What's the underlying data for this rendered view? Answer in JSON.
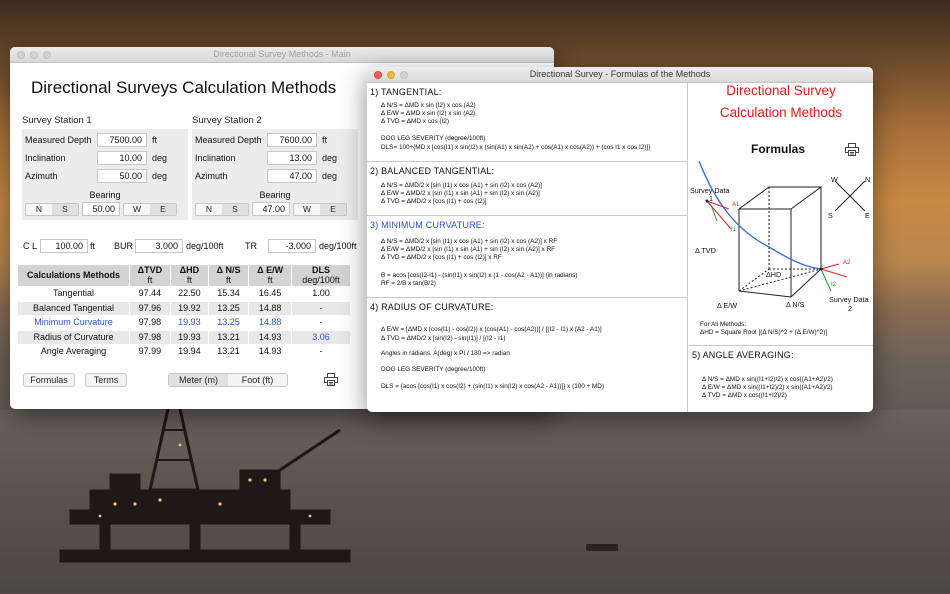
{
  "main": {
    "window_title": "Directional Survey Methods - Main",
    "app_title": "Directional Surveys Calculation Methods",
    "stations": [
      {
        "label": "Survey Station 1",
        "md_label": "Measured Depth",
        "md": "7500.00",
        "md_unit": "ft",
        "inc_label": "Inclination",
        "inc": "10.00",
        "inc_unit": "deg",
        "az_label": "Azimuth",
        "az": "50.00",
        "az_unit": "deg",
        "bearing_label": "Bearing",
        "ns": [
          "N",
          "S"
        ],
        "bearing": "50.00",
        "ew": [
          "W",
          "E"
        ]
      },
      {
        "label": "Survey Station 2",
        "md_label": "Measured Depth",
        "md": "7600.00",
        "md_unit": "ft",
        "inc_label": "Inclination",
        "inc": "13.00",
        "inc_unit": "deg",
        "az_label": "Azimuth",
        "az": "47.00",
        "az_unit": "deg",
        "bearing_label": "Bearing",
        "ns": [
          "N",
          "S"
        ],
        "bearing": "47.00",
        "ew": [
          "W",
          "E"
        ]
      }
    ],
    "cl_label": "C L",
    "cl": "100.00",
    "cl_unit": "ft",
    "bur_label": "BUR",
    "bur": "3.000",
    "bur_unit": "deg/100ft",
    "tr_label": "TR",
    "tr": "-3.000",
    "tr_unit": "deg/100ft",
    "table": {
      "headers": [
        {
          "name": "Calculations Methods",
          "unit": ""
        },
        {
          "name": "ΔTVD",
          "unit": "ft"
        },
        {
          "name": "ΔHD",
          "unit": "ft"
        },
        {
          "name": "Δ N/S",
          "unit": "ft"
        },
        {
          "name": "Δ E/W",
          "unit": "ft"
        },
        {
          "name": "DLS",
          "unit": "deg/100ft"
        }
      ],
      "rows": [
        [
          "Tangential",
          "97.44",
          "22.50",
          "15.34",
          "16.45",
          "1.00"
        ],
        [
          "Balanced Tangential",
          "97.96",
          "19.92",
          "13.25",
          "14.88",
          "-"
        ],
        [
          "Minimum Curvature",
          "97.98",
          "19.93",
          "13.25",
          "14.88",
          "-"
        ],
        [
          "Radius of Curvature",
          "97.98",
          "19.93",
          "13.21",
          "14.93",
          "3.06"
        ],
        [
          "Angle Averaging",
          "97.99",
          "19.94",
          "13.21",
          "14.93",
          "-"
        ]
      ]
    },
    "buttons": {
      "formulas": "Formulas",
      "terms": "Terms"
    },
    "units": [
      "Meter (m)",
      "Foot (ft)"
    ],
    "print_icon": "printer-icon",
    "highlight_color": "#2a55c8"
  },
  "formulas": {
    "window_title": "Directional Survey - Formulas of the Methods",
    "sections": [
      {
        "title": "1) TANGENTIAL:",
        "lines": [
          "Δ N/S = ΔMD x sin (I2) x cos (A2)",
          "Δ E/W = ΔMD x sin (I2) x sin (A2)",
          "Δ TVD = ΔMD x cos (I2)",
          "",
          "DOG LEG SEVERITY (degree/100ft)",
          "DLS= 100÷{MD x [cos(I1) x sin(I2) x (sin(A1) x sin(A2) + cos(A1) x cos(A2)) + (cos I1 x cos I2)]}"
        ]
      },
      {
        "title": "2) BALANCED TANGENTIAL:",
        "lines": [
          "Δ N/S = ΔMD/2 x [sin (I1) x cos (A1) + sin (I2) x cos (A2)]",
          "Δ E/W = ΔMD/2 x [sin (I1) x sin (A1) + sin (I2) x sin (A2)]",
          "Δ TVD = ΔMD/2 x [cos (I1) + cos (I2)]"
        ]
      },
      {
        "title": "3) MINIMUM CURVATURE:",
        "lines": [
          "Δ N/S = ΔMD/2 x [sin (I1) x cos (A1) + sin (I2) x cos (A2)] x RF",
          "Δ E/W = ΔMD/2 x [sin (I1) x sin (A1) + sin (I2) x sin (A2)] x RF",
          "Δ TVD = ΔMD/2 x [cos (I1) + cos (I2)] x RF",
          "",
          "B = acos [cos(I2-I1) - (sin(I1) x sin(I2) x (1 - cos(A2 - A1))]  (in radians)",
          "RF = 2/B x tan(B/2)"
        ]
      },
      {
        "title": "4) RADIUS OF CURVATURE:",
        "lines": [
          "Δ E/W = [ΔMD x (cos(I1) - cos(I2)) x (cos(A1) - cos(A2))] / [(I2 - I1) x (A2 - A1)]",
          "Δ TVD = ΔMD/2 x [sin(I2) - sin(I1)] / [(I2 - I1)",
          "",
          "Angles in radians.     A(deg) x PI / 180 => radian",
          "",
          "DOG LEG SEVERITY (degree/100ft)",
          "",
          "DLS = {acos [cos(I1) x cos(I2) + (sin(I1) x sin(I2) x cos(A2 - A1))]} x (100 ÷ MD)"
        ]
      }
    ],
    "right": {
      "title_line1": "Directional Survey",
      "title_line2": "Calculation Methods",
      "subtitle": "Formulas",
      "print_icon": "printer-icon",
      "diagram_labels": {
        "survey_data_1": "Survey Data",
        "one": "1",
        "tvd": "Δ TVD",
        "hd": "ΔHD",
        "ew": "Δ E/W",
        "ns": "Δ N/S",
        "survey_data_2": "Survey Data",
        "two": "2",
        "a1": "A1",
        "a2": "A2",
        "i1": "I1",
        "i2": "I2",
        "compass_w": "W",
        "compass_n": "N",
        "compass_s": "S",
        "compass_e": "E"
      },
      "all_methods_1": "For All Methods:",
      "all_methods_2": "ΔHD = Square Root [(Δ N/S)^2 + (Δ E/W)^2)]",
      "aa_title": "5) ANGLE AVERAGING:",
      "aa_lines": [
        "Δ N/S = ΔMD x sin((I1+I2)/2) x cos((A1+A2)/2)",
        "Δ E/W = ΔMD x sin((I1+I2)/2) x sin((A1+A2)/2)",
        "Δ TVD = ΔMD x cos((I1+I2)/2)"
      ],
      "title_color": "#e31b1b"
    }
  }
}
